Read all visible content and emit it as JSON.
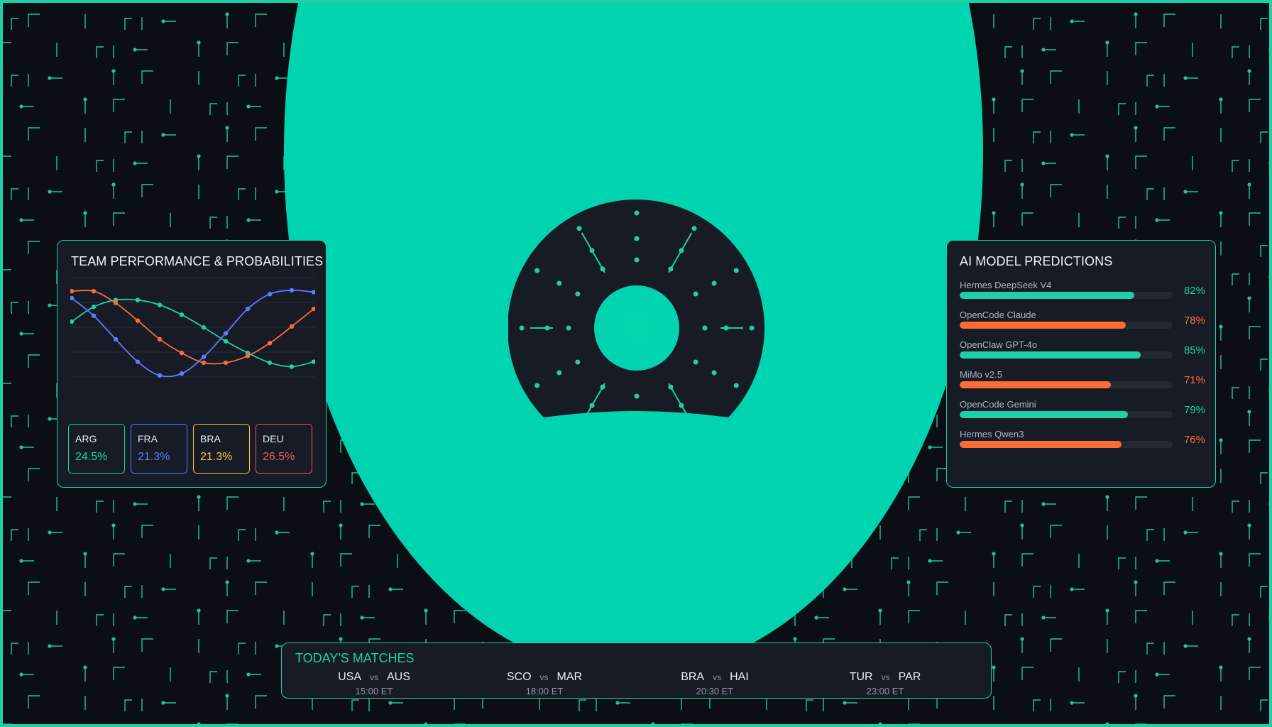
{
  "colors": {
    "accent": "#1fcfa6",
    "orange": "#ff6b35",
    "blue": "#5b7cff",
    "background": "#0b0e14",
    "panel": "#161b25",
    "center_circle": "#00d4ae"
  },
  "team_panel": {
    "title": "TEAM PERFORMANCE & PROBABILITIES",
    "cards": [
      {
        "code": "ARG",
        "prob": "24.5%",
        "color": "#1fcfa6"
      },
      {
        "code": "FRA",
        "prob": "21.3%",
        "color": "#5b7cff"
      },
      {
        "code": "BRA",
        "prob": "21.3%",
        "color": "#f5c542"
      },
      {
        "code": "DEU",
        "prob": "26.5%",
        "color": "#f0575f"
      }
    ]
  },
  "chart_data": {
    "type": "line",
    "title": "",
    "xlabel": "",
    "ylabel": "",
    "x": [
      0,
      1,
      2,
      3,
      4,
      5,
      6,
      7,
      8,
      9,
      10,
      11
    ],
    "ylim": [
      0,
      100
    ],
    "grid": true,
    "legend": "none",
    "series": [
      {
        "color": "#1fcfa6",
        "values": [
          58,
          73,
          80,
          80,
          75,
          65,
          52,
          38,
          26,
          16,
          12,
          17
        ]
      },
      {
        "color": "#ff6b35",
        "values": [
          89,
          89,
          77,
          59,
          40,
          26,
          16,
          16,
          23,
          36,
          53,
          71
        ]
      },
      {
        "color": "#5b7cff",
        "values": [
          82,
          64,
          40,
          17,
          3,
          5,
          22,
          46,
          71,
          86,
          90,
          88
        ]
      }
    ]
  },
  "predictions": {
    "title": "AI MODEL PREDICTIONS",
    "items": [
      {
        "name": "Hermes DeepSeek V4",
        "pct": "82%",
        "value": 0.82,
        "color": "#1fcfa6"
      },
      {
        "name": "OpenCode Claude",
        "pct": "78%",
        "value": 0.78,
        "color": "#ff6b35"
      },
      {
        "name": "OpenClaw GPT-4o",
        "pct": "85%",
        "value": 0.85,
        "color": "#1fcfa6"
      },
      {
        "name": "MiMo v2.5",
        "pct": "71%",
        "value": 0.71,
        "color": "#ff6b35"
      },
      {
        "name": "OpenCode Gemini",
        "pct": "79%",
        "value": 0.79,
        "color": "#1fcfa6"
      },
      {
        "name": "Hermes Qwen3",
        "pct": "76%",
        "value": 0.76,
        "color": "#ff6b35"
      }
    ]
  },
  "matches": {
    "title": "TODAY'S MATCHES",
    "vs_label": "vs",
    "items": [
      {
        "home": "USA",
        "away": "AUS",
        "time": "15:00 ET"
      },
      {
        "home": "SCO",
        "away": "MAR",
        "time": "18:00 ET"
      },
      {
        "home": "BRA",
        "away": "HAI",
        "time": "20:30 ET"
      },
      {
        "home": "TUR",
        "away": "PAR",
        "time": "23:00 ET"
      }
    ]
  }
}
